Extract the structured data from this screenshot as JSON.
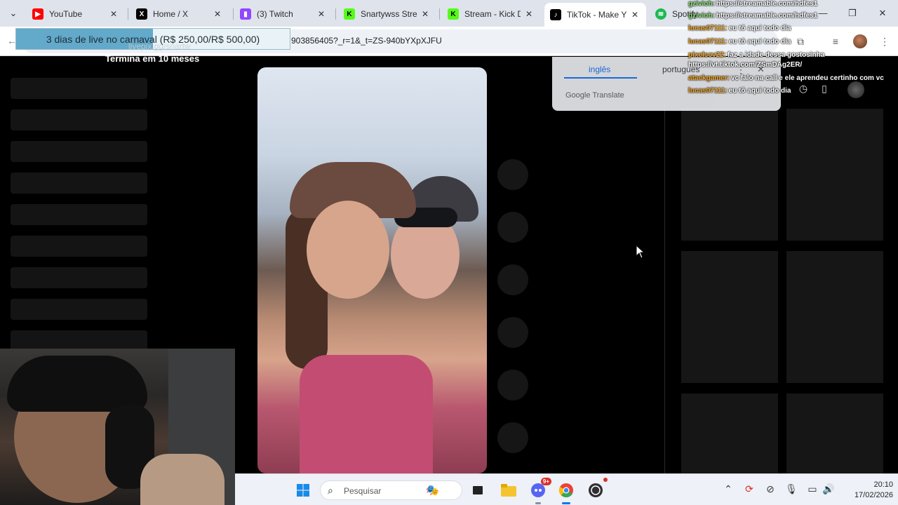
{
  "tabs": [
    {
      "label": "YouTube",
      "icon": "youtube-icon",
      "color": "#ff0000"
    },
    {
      "label": "Home / X",
      "icon": "x-icon",
      "color": "#000000"
    },
    {
      "label": "(3) Twitch",
      "icon": "twitch-icon",
      "color": "#9146ff"
    },
    {
      "label": "Snartywss Strea",
      "icon": "kick-icon",
      "color": "#53fc18"
    },
    {
      "label": "Stream - Kick D",
      "icon": "kick-icon",
      "color": "#53fc18"
    },
    {
      "label": "TikTok - Make Y",
      "icon": "tiktok-icon",
      "color": "#000000"
    },
    {
      "label": "Spotify",
      "icon": "spotify-icon",
      "color": "#1db954"
    }
  ],
  "address": {
    "url": "903856405?_r=1&_t=ZS-940bYXpXJFU"
  },
  "sub_goal": {
    "text": "3 dias de live no carnaval (R$ 250,00/R$ 500,00)",
    "progress": 0.5,
    "overlay_url": "livepix.gg/snartw",
    "ends": "Termina em 10 meses"
  },
  "translate": {
    "tab_source": "inglês",
    "tab_target": "portugues",
    "brand": "Google Translate"
  },
  "chat": [
    {
      "user": "gzivioh:",
      "text": "https://streamable.com/hdfes1",
      "color": "#8fe07a"
    },
    {
      "user": "gzivioh:",
      "text": "https://streamable.com/hdfes1",
      "color": "#8fe07a"
    },
    {
      "user": "lucas07111:",
      "text": "eu tô aqui todo dia",
      "color": "#f5a623"
    },
    {
      "user": "lucas07111:",
      "text": "eu tô aqui todo dia",
      "color": "#f5a623"
    },
    {
      "user": "pixelscv22:",
      "text": "faz a idade dessa gostosinha",
      "color": "#f5a623"
    },
    {
      "user": "",
      "text": "https://vt.tiktok.com/ZSmDAg2ER/",
      "color": "#ffffff"
    },
    {
      "user": "atackgamer:",
      "text": "vc falo na call e ele aprendeu certinho com vc",
      "color": "#f5a623"
    },
    {
      "user": "lucas07111:",
      "text": "eu tô aqui todo dia",
      "color": "#f5a623"
    }
  ],
  "taskbar": {
    "search_placeholder": "Pesquisar",
    "discord_badge": "9+",
    "clock_time": "20:10",
    "clock_date": "17/02/2026"
  }
}
